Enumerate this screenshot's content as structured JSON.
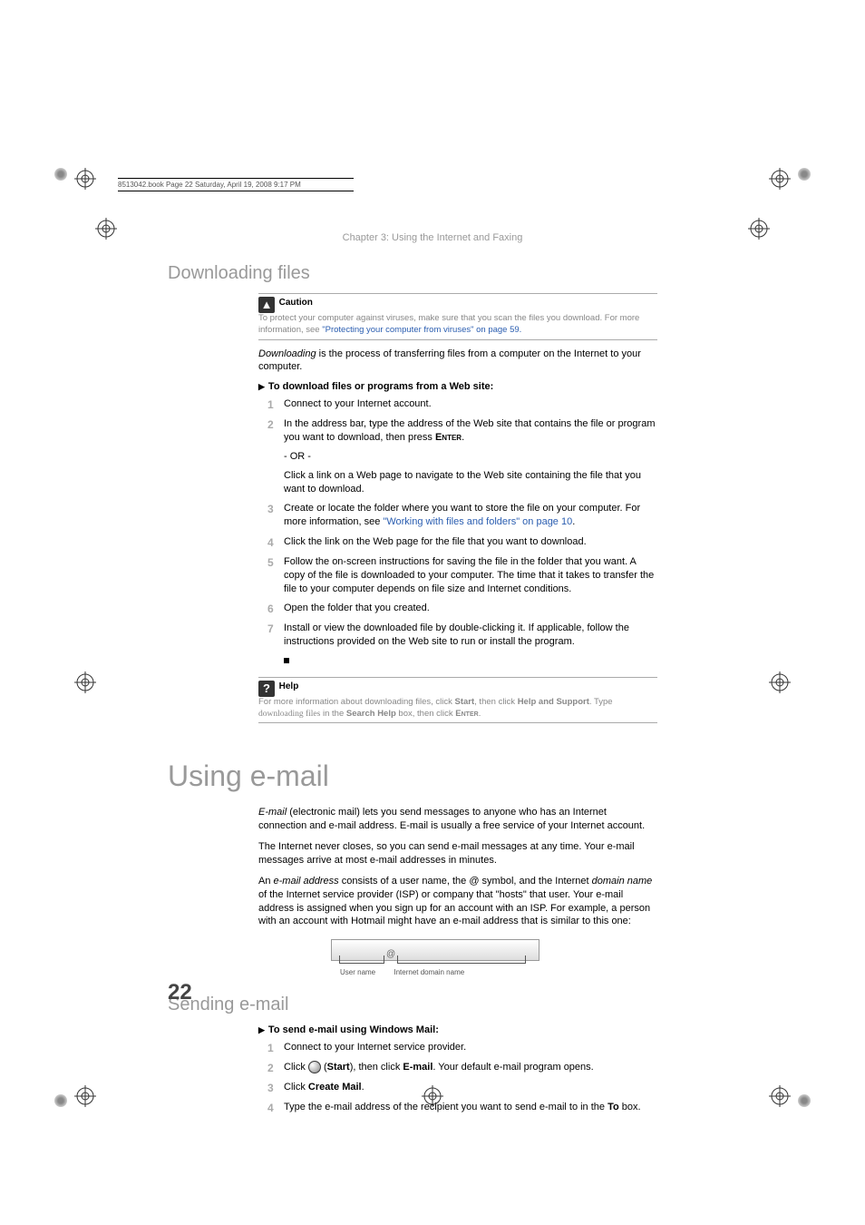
{
  "header_line": "8513042.book  Page 22  Saturday, April 19, 2008  9:17 PM",
  "chapter": "Chapter 3: Using the Internet and Faxing",
  "section1": {
    "title": "Downloading files",
    "caution": {
      "label": "Caution",
      "body": "To protect your computer against viruses, make sure that you scan the files you download. For more information, see ",
      "link": "\"Protecting your computer from viruses\" on page 59."
    },
    "intro_prefix": "Downloading",
    "intro_rest": " is the process of transferring files from a computer on the Internet to your computer.",
    "task_head": "To download files or programs from a Web site:",
    "steps": {
      "s1": "Connect to your Internet account.",
      "s2a": "In the address bar, type the address of the Web site that contains the file or program you want to download, then press ",
      "s2b": "Enter",
      "s2c": ".",
      "s2_or": "- OR -",
      "s2d": "Click a link on a Web page to navigate to the Web site containing the file that you want to download.",
      "s3a": "Create or locate the folder where you want to store the file on your computer. For more information, see ",
      "s3link": "\"Working with files and folders\" on page 10",
      "s3b": ".",
      "s4": "Click the link on the Web page for the file that you want to download.",
      "s5": "Follow the on-screen instructions for saving the file in the folder that you want. A copy of the file is downloaded to your computer. The time that it takes to transfer the file to your computer depends on file size and Internet conditions.",
      "s6": "Open the folder that you created.",
      "s7": "Install or view the downloaded file by double-clicking it. If applicable, follow the instructions provided on the Web site to run or install the program."
    },
    "help": {
      "label": "Help",
      "b1": "For more information about downloading files, click ",
      "b2": "Start",
      "b3": ", then click ",
      "b4": "Help and Support",
      "b5": ". Type ",
      "b6": "downloading files",
      "b7": " in the ",
      "b8": "Search Help",
      "b9": " box, then click ",
      "b10": "Enter",
      "b11": "."
    }
  },
  "section2": {
    "title": "Using e-mail",
    "p1_prefix": "E-mail",
    "p1_rest": " (electronic mail) lets you send messages to anyone who has an Internet connection and e-mail address. E-mail is usually a free service of your Internet account.",
    "p2": "The Internet never closes, so you can send e-mail messages at any time. Your e-mail messages arrive at most e-mail addresses in minutes.",
    "p3a": "An ",
    "p3b": "e-mail address",
    "p3c": " consists of a user name, the @ symbol, and the Internet ",
    "p3d": "domain name",
    "p3e": " of the Internet service provider (ISP) or company that \"hosts\" that user. Your e-mail address is assigned when you sign up for an account with an ISP. For example, a person with an account with Hotmail might have an e-mail address that is similar to this one:",
    "diagram": {
      "label1": "User name",
      "label2": "Internet domain name"
    }
  },
  "section3": {
    "title": "Sending e-mail",
    "task_head": "To send e-mail using Windows Mail:",
    "steps": {
      "s1": "Connect to your Internet service provider.",
      "s2a": "Click ",
      "s2b": " (",
      "s2c": "Start",
      "s2d": "), then click ",
      "s2e": "E-mail",
      "s2f": ". Your default e-mail program opens.",
      "s3a": "Click ",
      "s3b": "Create Mail",
      "s3c": ".",
      "s4a": "Type the e-mail address of the recipient you want to send e-mail to in the ",
      "s4b": "To",
      "s4c": " box."
    }
  },
  "page_number": "22"
}
